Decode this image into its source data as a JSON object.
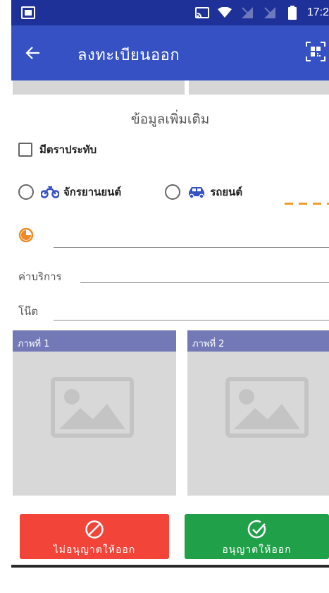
{
  "status_bar": {
    "time": "17:2",
    "icons": [
      "cast-icon",
      "wifi-icon",
      "signal-off-icon",
      "signal-off-icon",
      "battery-icon"
    ]
  },
  "app_bar": {
    "title": "ลงทะเบียนออก",
    "back_icon": "arrow-left-icon",
    "scan_icon": "qr-scan-icon"
  },
  "section": {
    "title": "ข้อมูลเพิ่มเติม"
  },
  "checkbox": {
    "label": "มีตราประทับ",
    "checked": false
  },
  "vehicle_type": {
    "options": [
      {
        "label": "จักรยานยนต์",
        "icon": "motorcycle-icon",
        "selected": false
      },
      {
        "label": "รถยนต์",
        "icon": "car-icon",
        "selected": false
      }
    ]
  },
  "time_field": {
    "icon": "clock-icon",
    "value": ""
  },
  "fields": [
    {
      "label": "ค่าบริการ",
      "value": ""
    },
    {
      "label": "โน๊ต",
      "value": ""
    }
  ],
  "photos": [
    {
      "label": "ภาพที่ 1",
      "icon": "image-placeholder-icon"
    },
    {
      "label": "ภาพที่ 2",
      "icon": "image-placeholder-icon"
    }
  ],
  "buttons": {
    "deny": {
      "label": "ไม่อนุญาตให้ออก",
      "icon": "ban-icon",
      "color": "#f24438"
    },
    "allow": {
      "label": "อนุญาตให้ออก",
      "icon": "check-circle-icon",
      "color": "#20a049"
    }
  },
  "colors": {
    "status_bar": "#1e3199",
    "app_bar": "#3551c4",
    "photo_header": "#7379b6",
    "accent_orange": "#f39a2c",
    "vehicle_icon": "#3551c4"
  }
}
